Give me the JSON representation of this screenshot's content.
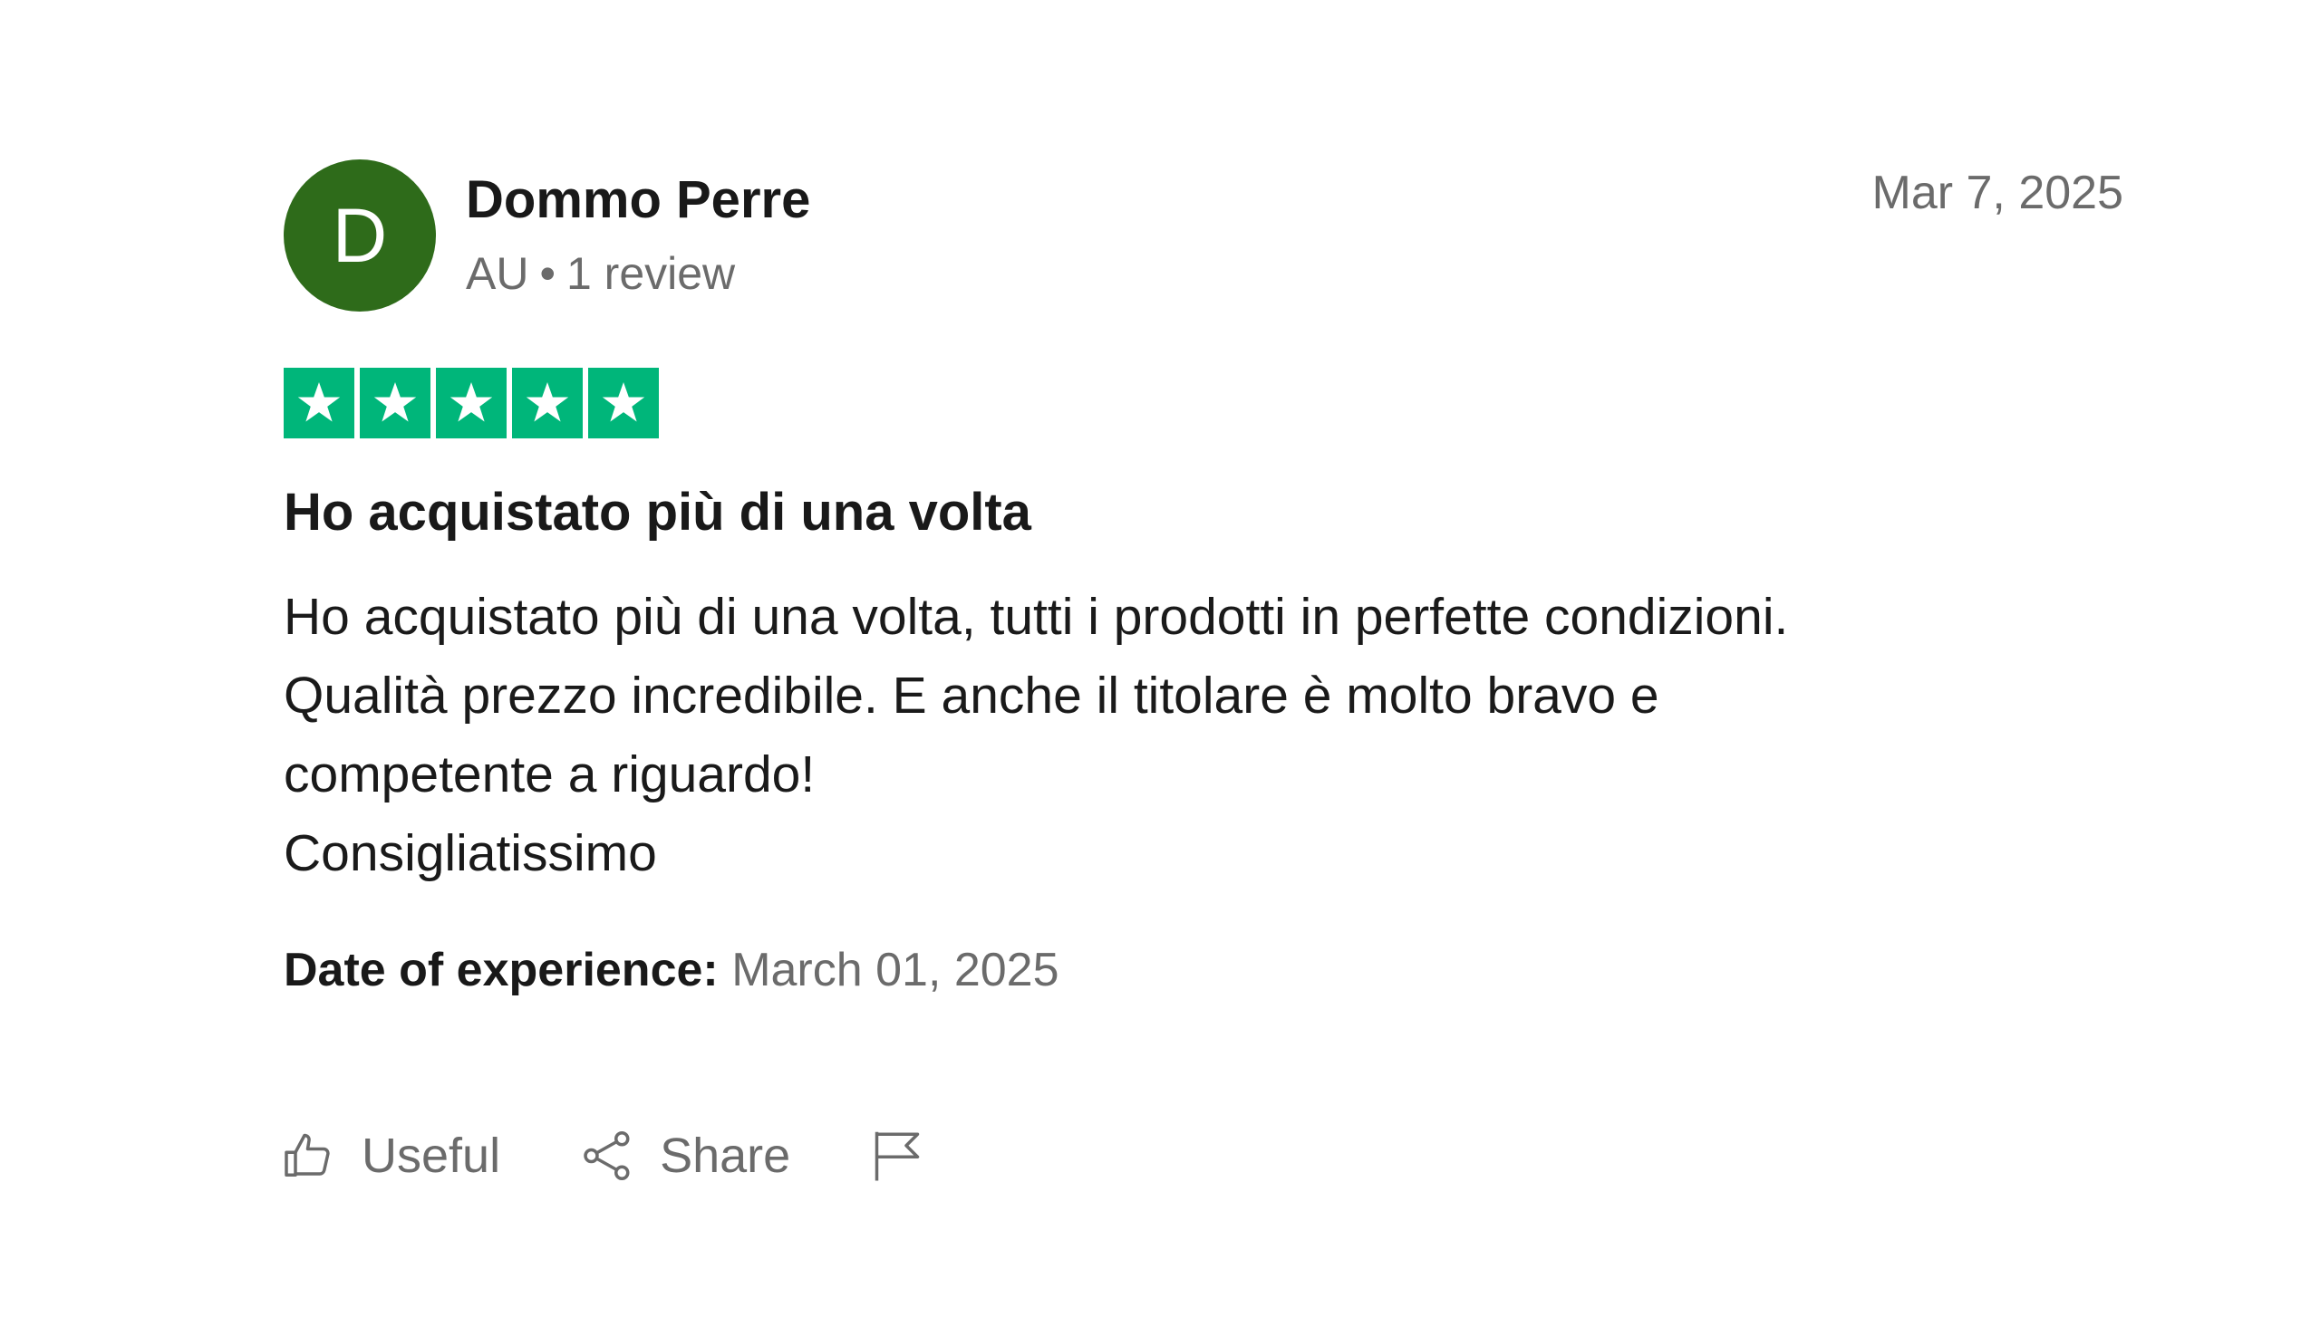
{
  "reviewer": {
    "initial": "D",
    "name": "Dommo Perre",
    "country": "AU",
    "separator": "•",
    "review_count": "1 review",
    "avatar_color": "#2e6b1a"
  },
  "review": {
    "date": "Mar 7, 2025",
    "rating": 5,
    "star_color": "#00b67a",
    "title": "Ho acquistato più di una volta",
    "body_lines": [
      "Ho acquistato più di una volta, tutti i prodotti in perfette condizioni.",
      "Qualità prezzo incredibile. E anche il titolare è molto bravo e",
      "competente a riguardo!",
      "Consigliatissimo"
    ],
    "experience_label": "Date of experience:",
    "experience_date": "March 01, 2025"
  },
  "actions": {
    "useful_label": "Useful",
    "useful_icon": "thumbs-up-icon",
    "share_label": "Share",
    "share_icon": "share-icon",
    "report_icon": "flag-icon"
  }
}
